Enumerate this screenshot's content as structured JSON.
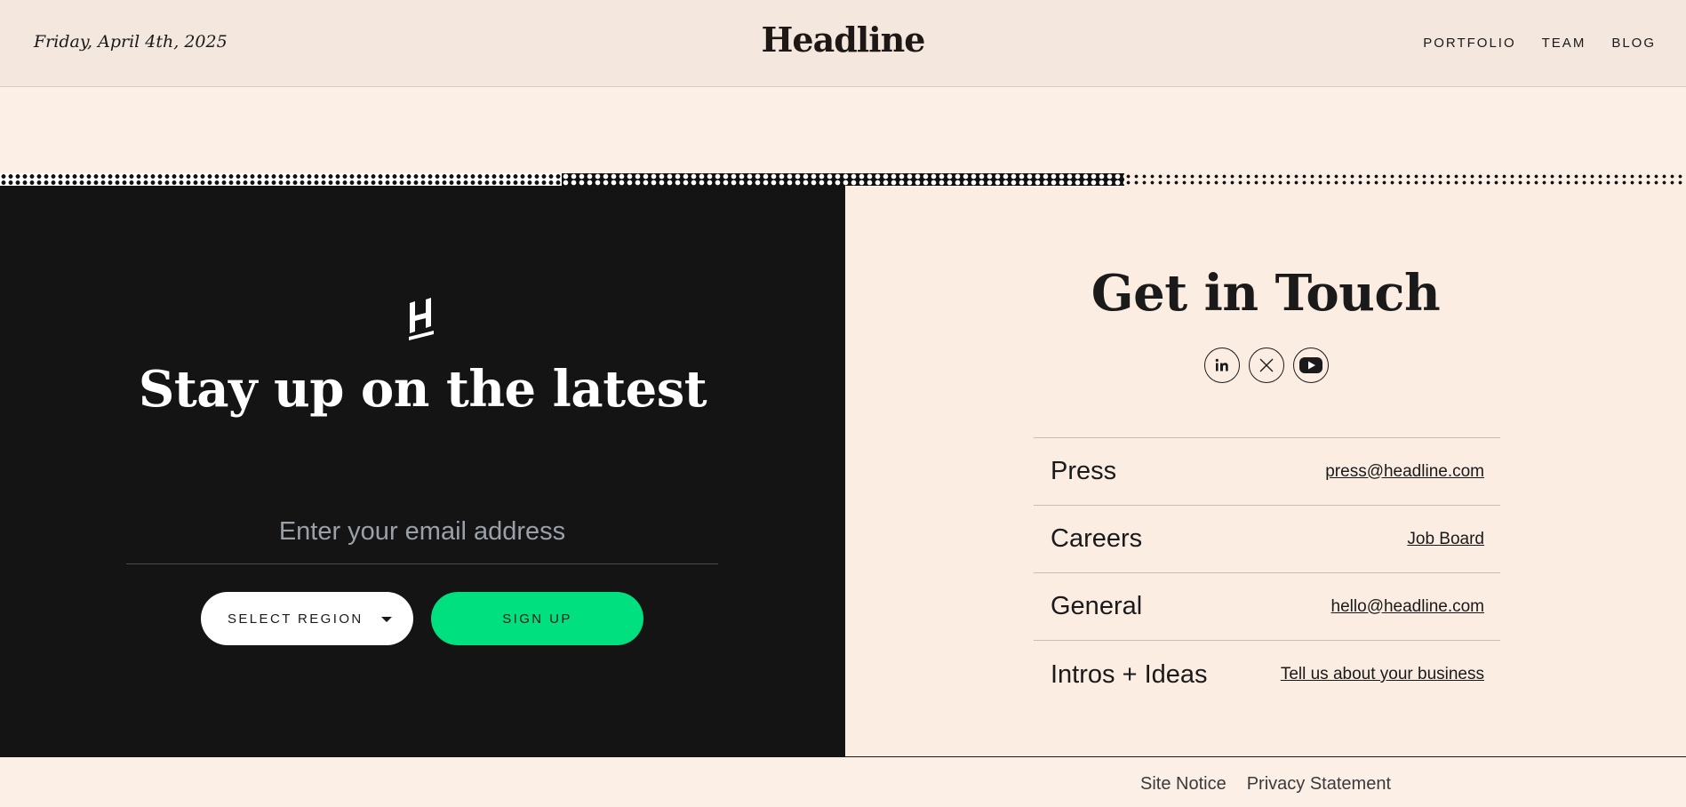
{
  "header": {
    "date": "Friday, April 4th, 2025",
    "brand": "Headline",
    "nav": [
      {
        "label": "PORTFOLIO"
      },
      {
        "label": "TEAM"
      },
      {
        "label": "BLOG"
      }
    ]
  },
  "newsletter": {
    "logo_icon": "h-logo-icon",
    "title": "Stay up on the latest",
    "email_placeholder": "Enter your email address",
    "region_label": "SELECT REGION",
    "signup_label": "SIGN UP"
  },
  "contact": {
    "title": "Get in Touch",
    "socials": [
      {
        "icon": "linkedin-icon"
      },
      {
        "icon": "x-icon"
      },
      {
        "icon": "youtube-icon"
      }
    ],
    "rows": [
      {
        "label": "Press",
        "link": "press@headline.com"
      },
      {
        "label": "Careers",
        "link": "Job Board"
      },
      {
        "label": "General",
        "link": "hello@headline.com"
      },
      {
        "label": "Intros + Ideas",
        "link": "Tell us about your business"
      }
    ]
  },
  "footer": {
    "links": [
      {
        "label": "Site Notice"
      },
      {
        "label": "Privacy Statement"
      }
    ]
  },
  "colors": {
    "page_bg": "#fcefe6",
    "header_bg": "#f4e7de",
    "dark_panel": "#141414",
    "accent_green": "#00e07f"
  }
}
